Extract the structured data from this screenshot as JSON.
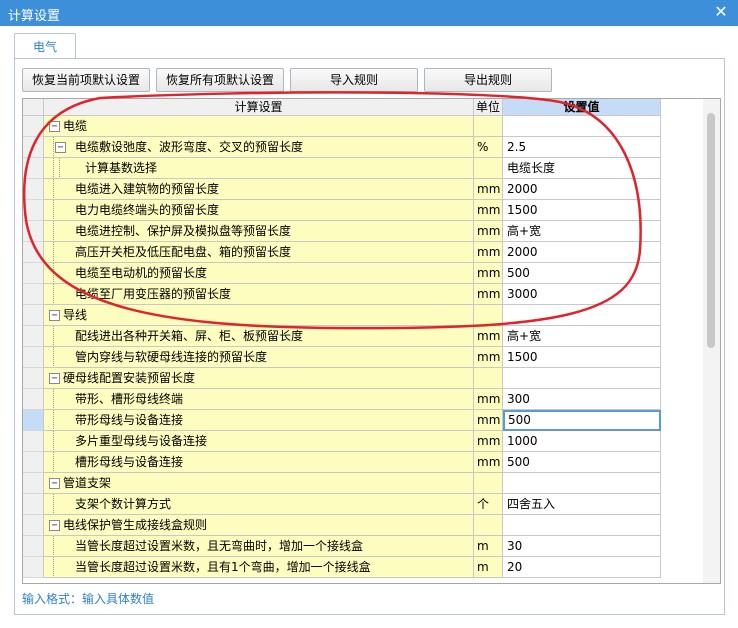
{
  "window": {
    "title": "计算设置",
    "close_glyph": "✕"
  },
  "tabs": [
    {
      "label": "电气"
    }
  ],
  "toolbar": {
    "restore_current": "恢复当前项默认设置",
    "restore_all": "恢复所有项默认设置",
    "import_rules": "导入规则",
    "export_rules": "导出规则"
  },
  "grid": {
    "headers": {
      "setting": "计算设置",
      "unit": "单位",
      "value": "设置值"
    },
    "rows": [
      {
        "label": "电缆",
        "unit": "",
        "value": "",
        "level": 0,
        "expander": "−"
      },
      {
        "label": "电缆敷设弛度、波形弯度、交叉的预留长度",
        "unit": "%",
        "value": "2.5",
        "level": 1,
        "expander": "−"
      },
      {
        "label": "计算基数选择",
        "unit": "",
        "value": "电缆长度",
        "level": 2
      },
      {
        "label": "电缆进入建筑物的预留长度",
        "unit": "mm",
        "value": "2000",
        "level": 1
      },
      {
        "label": "电力电缆终端头的预留长度",
        "unit": "mm",
        "value": "1500",
        "level": 1
      },
      {
        "label": "电缆进控制、保护屏及模拟盘等预留长度",
        "unit": "mm",
        "value": "高+宽",
        "level": 1
      },
      {
        "label": "高压开关柜及低压配电盘、箱的预留长度",
        "unit": "mm",
        "value": "2000",
        "level": 1
      },
      {
        "label": "电缆至电动机的预留长度",
        "unit": "mm",
        "value": "500",
        "level": 1
      },
      {
        "label": "电缆至厂用变压器的预留长度",
        "unit": "mm",
        "value": "3000",
        "level": 1
      },
      {
        "label": "导线",
        "unit": "",
        "value": "",
        "level": 0,
        "expander": "−"
      },
      {
        "label": "配线进出各种开关箱、屏、柜、板预留长度",
        "unit": "mm",
        "value": "高+宽",
        "level": 1
      },
      {
        "label": "管内穿线与软硬母线连接的预留长度",
        "unit": "mm",
        "value": "1500",
        "level": 1
      },
      {
        "label": "硬母线配置安装预留长度",
        "unit": "",
        "value": "",
        "level": 0,
        "expander": "−"
      },
      {
        "label": "带形、槽形母线终端",
        "unit": "mm",
        "value": "300",
        "level": 1
      },
      {
        "label": "带形母线与设备连接",
        "unit": "mm",
        "value": "500",
        "level": 1,
        "current": true
      },
      {
        "label": "多片重型母线与设备连接",
        "unit": "mm",
        "value": "1000",
        "level": 1
      },
      {
        "label": "槽形母线与设备连接",
        "unit": "mm",
        "value": "500",
        "level": 1
      },
      {
        "label": "管道支架",
        "unit": "",
        "value": "",
        "level": 0,
        "expander": "−"
      },
      {
        "label": "支架个数计算方式",
        "unit": "个",
        "value": "四舍五入",
        "level": 1
      },
      {
        "label": "电线保护管生成接线盒规则",
        "unit": "",
        "value": "",
        "level": 0,
        "expander": "−"
      },
      {
        "label": "当管长度超过设置米数，且无弯曲时，增加一个接线盒",
        "unit": "m",
        "value": "30",
        "level": 1
      },
      {
        "label": "当管长度超过设置米数，且有1个弯曲，增加一个接线盒",
        "unit": "m",
        "value": "20",
        "level": 1
      }
    ]
  },
  "status": {
    "text": "输入格式：输入具体数值"
  },
  "colors": {
    "title_bar": "#3c8fd8",
    "label_cell": "#fdfdc0",
    "selection": "#c5dcf6",
    "focus_border": "#5b9bd5",
    "hint_text": "#2f7fcf",
    "annotation": "#e0242b"
  }
}
